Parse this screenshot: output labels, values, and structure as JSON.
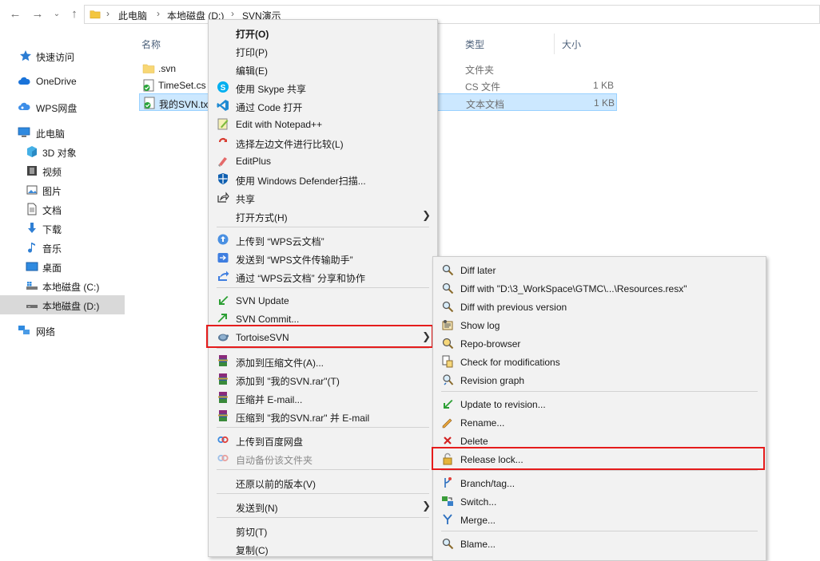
{
  "address": {
    "crumbs": [
      "此电脑",
      "本地磁盘 (D:)",
      "SVN演示"
    ]
  },
  "nav": {
    "quick_access": "快速访问",
    "onedrive": "OneDrive",
    "wps": "WPS网盘",
    "this_pc": "此电脑",
    "objects3d": "3D 对象",
    "video": "视频",
    "pictures": "图片",
    "documents": "文档",
    "downloads": "下载",
    "music": "音乐",
    "desktop": "桌面",
    "disk_c": "本地磁盘 (C:)",
    "disk_d": "本地磁盘 (D:)",
    "network": "网络"
  },
  "columns": {
    "name": "名称",
    "type": "类型",
    "size": "大小"
  },
  "files": [
    {
      "name": ".svn",
      "type": "文件夹",
      "size": ""
    },
    {
      "name": "TimeSet.cs",
      "type": "CS 文件",
      "size": "1 KB"
    },
    {
      "name": "我的SVN.txt",
      "type": "文本文档",
      "size": "1 KB"
    }
  ],
  "context_menu": {
    "open": "打开(O)",
    "print": "打印(P)",
    "edit": "编辑(E)",
    "skype": "使用 Skype 共享",
    "code": "通过 Code 打开",
    "notepadpp": "Edit with Notepad++",
    "compare": "选择左边文件进行比较(L)",
    "editplus": "EditPlus",
    "defender": "使用 Windows Defender扫描...",
    "share": "共享",
    "open_with": "打开方式(H)",
    "wps_upload": "上传到 “WPS云文档”",
    "wps_send": "发送到 “WPS文件传输助手”",
    "wps_share": "通过 “WPS云文档” 分享和协作",
    "svn_update": "SVN Update",
    "svn_commit": "SVN Commit...",
    "tortoise": "TortoiseSVN",
    "add_archive": "添加到压缩文件(A)...",
    "add_rar": "添加到 \"我的SVN.rar\"(T)",
    "zip_email": "压缩并 E-mail...",
    "zip_rar_email": "压缩到 \"我的SVN.rar\" 并 E-mail",
    "baidu_upload": "上传到百度网盘",
    "baidu_backup": "自动备份该文件夹",
    "restore": "还原以前的版本(V)",
    "send_to": "发送到(N)",
    "cut": "剪切(T)",
    "copy": "复制(C)"
  },
  "tortoise_menu": {
    "diff_later": "Diff later",
    "diff_with": "Diff with \"D:\\3_WorkSpace\\GTMC\\...\\Resources.resx\"",
    "diff_prev": "Diff with previous version",
    "show_log": "Show log",
    "repo_browser": "Repo-browser",
    "check_mod": "Check for modifications",
    "rev_graph": "Revision graph",
    "update_rev": "Update to revision...",
    "rename": "Rename...",
    "delete": "Delete",
    "release_lock": "Release lock...",
    "branch_tag": "Branch/tag...",
    "switch": "Switch...",
    "merge": "Merge...",
    "blame": "Blame..."
  },
  "colors": {
    "highlight_border": "#e51c1c",
    "selection": "#cce8ff"
  }
}
